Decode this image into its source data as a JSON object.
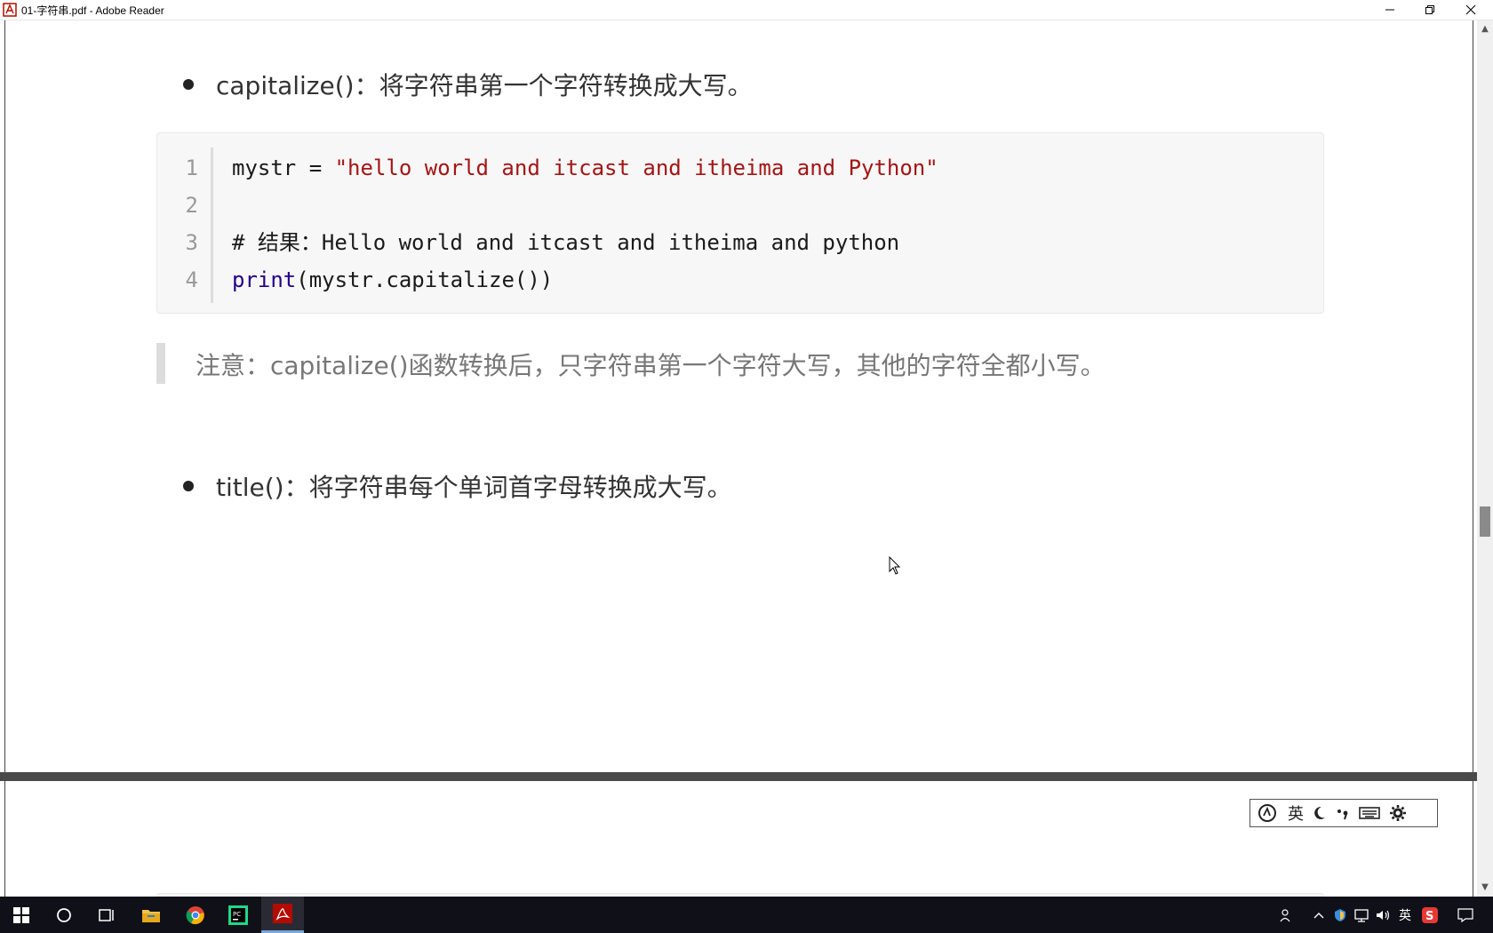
{
  "window": {
    "title": "01-字符串.pdf - Adobe Reader"
  },
  "doc": {
    "bullet1": "capitalize()：将字符串第一个字符转换成大写。",
    "code": {
      "line_numbers": [
        "1",
        "2",
        "3",
        "4"
      ],
      "line1_var": "mystr = ",
      "line1_str": "\"hello world and itcast and itheima and Python\"",
      "line3_comment": "# 结果：Hello world and itcast and itheima and python",
      "line4_kw": "print",
      "line4_rest": "(mystr.capitalize())"
    },
    "note": "注意：capitalize()函数转换后，只字符串第一个字符大写，其他的字符全都小写。",
    "bullet2": "title()：将字符串每个单词首字母转换成大写。"
  },
  "ime": {
    "lang": "英"
  },
  "taskbar": {
    "tray_lang": "英"
  },
  "colors": {
    "string": "#a31515",
    "comment": "#b05a1a",
    "keyword": "#220088",
    "taskbar": "#101018"
  }
}
